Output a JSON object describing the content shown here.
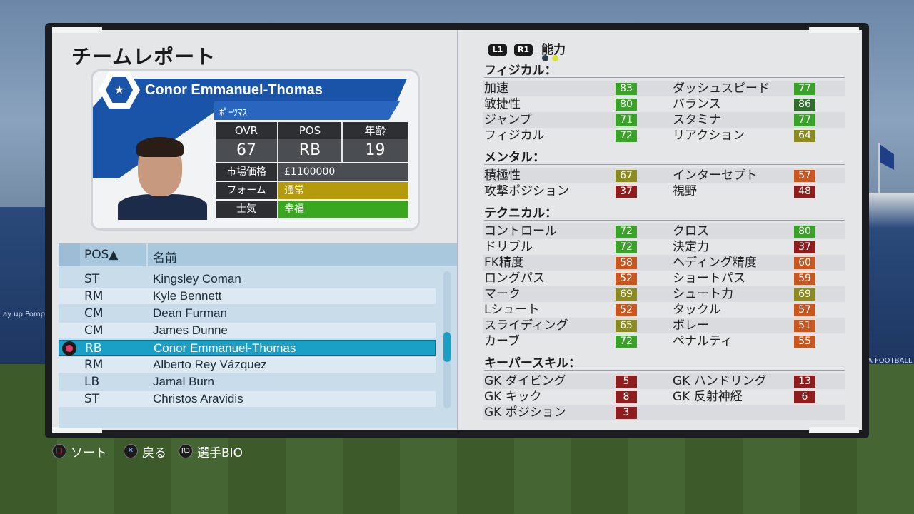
{
  "screen": {
    "title": "チームレポート"
  },
  "player": {
    "name": "Conor Emmanuel-Thomas",
    "club": "ﾎﾟｰﾂﾏｽ",
    "stats_headers": [
      "OVR",
      "POS",
      "年齢"
    ],
    "stats_values": [
      "67",
      "RB",
      "19"
    ],
    "market_value_label": "市場価格",
    "market_value": "£1100000",
    "form_label": "フォーム",
    "form": "通常",
    "morale_label": "士気",
    "morale": "幸福",
    "colors": {
      "form": "#b59a0c",
      "morale": "#39a820",
      "club": "#1a54a8"
    }
  },
  "squad": {
    "header_pos": "POS▲",
    "header_name": "名前",
    "rows": [
      {
        "pos": "ST",
        "name": "Kingsley Coman"
      },
      {
        "pos": "RM",
        "name": "Kyle Bennett"
      },
      {
        "pos": "CM",
        "name": "Dean Furman"
      },
      {
        "pos": "CM",
        "name": "James Dunne"
      },
      {
        "pos": "RB",
        "name": "Conor Emmanuel-Thomas",
        "selected": true
      },
      {
        "pos": "RM",
        "name": "Alberto Rey Vázquez"
      },
      {
        "pos": "LB",
        "name": "Jamal Burn"
      },
      {
        "pos": "ST",
        "name": "Christos Aravidis"
      }
    ]
  },
  "attributes": {
    "l1": "L1",
    "r1": "R1",
    "tab": "能力",
    "sections": [
      {
        "title": "フィジカル：",
        "rows": [
          [
            {
              "n": "加速",
              "v": "83",
              "c": "#3aa228"
            },
            {
              "n": "ダッシュスピード",
              "v": "77",
              "c": "#3aa228"
            }
          ],
          [
            {
              "n": "敏捷性",
              "v": "80",
              "c": "#3aa228"
            },
            {
              "n": "バランス",
              "v": "86",
              "c": "#2f6e2a"
            }
          ],
          [
            {
              "n": "ジャンプ",
              "v": "71",
              "c": "#3aa228"
            },
            {
              "n": "スタミナ",
              "v": "77",
              "c": "#3aa228"
            }
          ],
          [
            {
              "n": "フィジカル",
              "v": "72",
              "c": "#3aa228"
            },
            {
              "n": "リアクション",
              "v": "64",
              "c": "#8b8b21"
            }
          ]
        ]
      },
      {
        "title": "メンタル：",
        "rows": [
          [
            {
              "n": "積極性",
              "v": "67",
              "c": "#8b8b21"
            },
            {
              "n": "インターセプト",
              "v": "57",
              "c": "#c8561e"
            }
          ],
          [
            {
              "n": "攻撃ポジション",
              "v": "37",
              "c": "#8e1e1e"
            },
            {
              "n": "視野",
              "v": "48",
              "c": "#8e1e1e"
            }
          ]
        ]
      },
      {
        "title": "テクニカル：",
        "rows": [
          [
            {
              "n": "コントロール",
              "v": "72",
              "c": "#3aa228"
            },
            {
              "n": "クロス",
              "v": "80",
              "c": "#3aa228"
            }
          ],
          [
            {
              "n": "ドリブル",
              "v": "72",
              "c": "#3aa228"
            },
            {
              "n": "決定力",
              "v": "37",
              "c": "#8e1e1e"
            }
          ],
          [
            {
              "n": "FK精度",
              "v": "58",
              "c": "#c8561e"
            },
            {
              "n": "ヘディング精度",
              "v": "60",
              "c": "#c8561e"
            }
          ],
          [
            {
              "n": "ロングパス",
              "v": "52",
              "c": "#c8561e"
            },
            {
              "n": "ショートパス",
              "v": "59",
              "c": "#c8561e"
            }
          ],
          [
            {
              "n": "マーク",
              "v": "69",
              "c": "#8b8b21"
            },
            {
              "n": "シュート力",
              "v": "69",
              "c": "#8b8b21"
            }
          ],
          [
            {
              "n": "Lシュート",
              "v": "52",
              "c": "#c8561e"
            },
            {
              "n": "タックル",
              "v": "57",
              "c": "#c8561e"
            }
          ],
          [
            {
              "n": "スライディング",
              "v": "65",
              "c": "#8b8b21"
            },
            {
              "n": "ボレー",
              "v": "51",
              "c": "#c8561e"
            }
          ],
          [
            {
              "n": "カーブ",
              "v": "72",
              "c": "#3aa228"
            },
            {
              "n": "ペナルティ",
              "v": "55",
              "c": "#c8561e"
            }
          ]
        ]
      },
      {
        "title": "キーパースキル：",
        "rows": [
          [
            {
              "n": "GK ダイビング",
              "v": "5",
              "c": "#8e1e1e"
            },
            {
              "n": "GK ハンドリング",
              "v": "13",
              "c": "#8e1e1e"
            }
          ],
          [
            {
              "n": "GK キック",
              "v": "8",
              "c": "#8e1e1e"
            },
            {
              "n": "GK 反射神経",
              "v": "6",
              "c": "#8e1e1e"
            }
          ],
          [
            {
              "n": "GK ポジション",
              "v": "3",
              "c": "#8e1e1e"
            }
          ]
        ]
      }
    ]
  },
  "help": {
    "sort": "ソート",
    "back": "戻る",
    "r3": "R3",
    "bio": "選手BIO"
  },
  "background": {
    "banner_left": "ay up Pompey!",
    "banner_right": "A FOOTBALL FO"
  }
}
